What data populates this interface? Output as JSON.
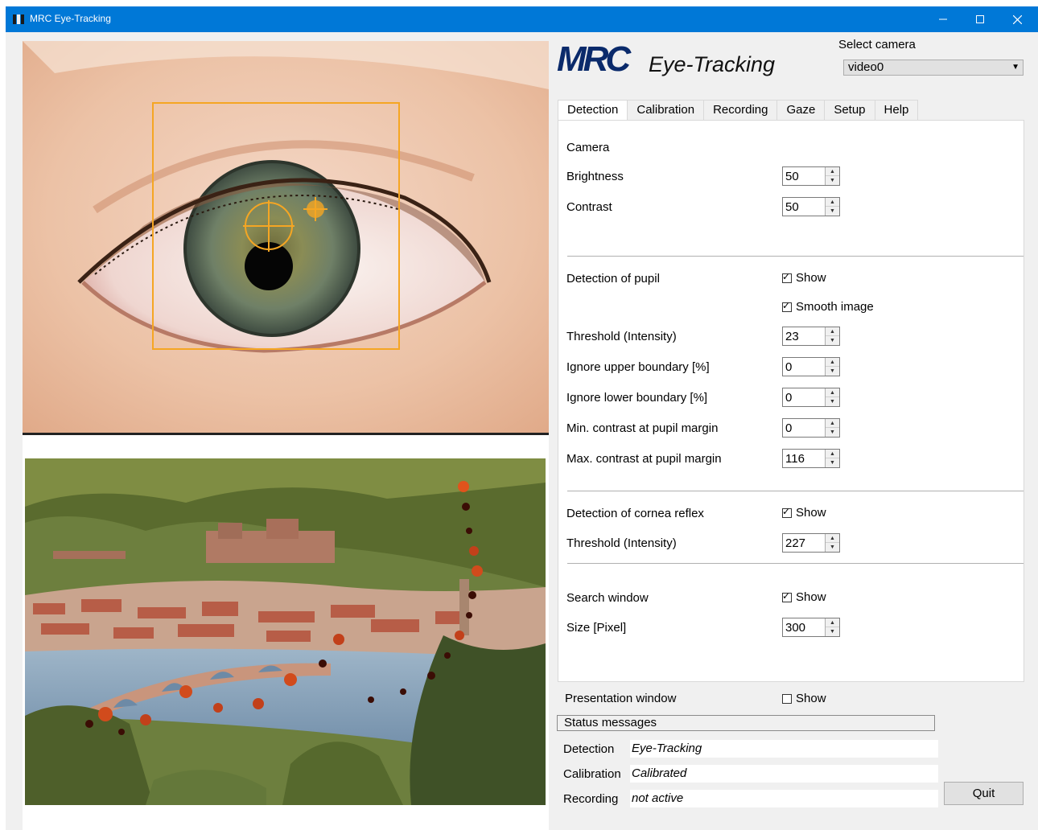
{
  "window": {
    "title": "MRC Eye-Tracking",
    "accent_color": "#0078d7",
    "minimize_icon": "minimize-icon",
    "maximize_icon": "maximize-icon",
    "close_icon": "close-icon"
  },
  "logo": {
    "brand": "MRC",
    "product": "Eye-Tracking",
    "brand_color": "#0a2a6b"
  },
  "camera_select": {
    "label": "Select camera",
    "value": "video0"
  },
  "tabs": [
    {
      "label": "Detection",
      "active": true
    },
    {
      "label": "Calibration"
    },
    {
      "label": "Recording"
    },
    {
      "label": "Gaze"
    },
    {
      "label": "Setup"
    },
    {
      "label": "Help"
    }
  ],
  "camera": {
    "heading": "Camera",
    "brightness_label": "Brightness",
    "brightness_value": "50",
    "contrast_label": "Contrast",
    "contrast_value": "50"
  },
  "pupil": {
    "heading": "Detection of pupil",
    "show_label": "Show",
    "show_checked": true,
    "smooth_label": "Smooth image",
    "smooth_checked": true,
    "threshold_label": "Threshold (Intensity)",
    "threshold_value": "23",
    "ignore_upper_label": "Ignore upper boundary [%]",
    "ignore_upper_value": "0",
    "ignore_lower_label": "Ignore lower boundary [%]",
    "ignore_lower_value": "0",
    "min_contrast_label": "Min. contrast at pupil margin",
    "min_contrast_value": "0",
    "max_contrast_label": "Max. contrast at pupil margin",
    "max_contrast_value": "116"
  },
  "cornea": {
    "heading": "Detection of cornea reflex",
    "show_label": "Show",
    "show_checked": true,
    "threshold_label": "Threshold (Intensity)",
    "threshold_value": "227"
  },
  "search_window": {
    "heading": "Search window",
    "show_label": "Show",
    "show_checked": true,
    "size_label": "Size [Pixel]",
    "size_value": "300"
  },
  "presentation": {
    "label": "Presentation window",
    "show_label": "Show",
    "show_checked": false
  },
  "status": {
    "header": "Status messages",
    "detection_label": "Detection",
    "detection_value": "Eye-Tracking",
    "calibration_label": "Calibration",
    "calibration_value": "Calibrated",
    "recording_label": "Recording",
    "recording_value": "not active"
  },
  "quit_label": "Quit",
  "overlay_color": "#f5a623"
}
